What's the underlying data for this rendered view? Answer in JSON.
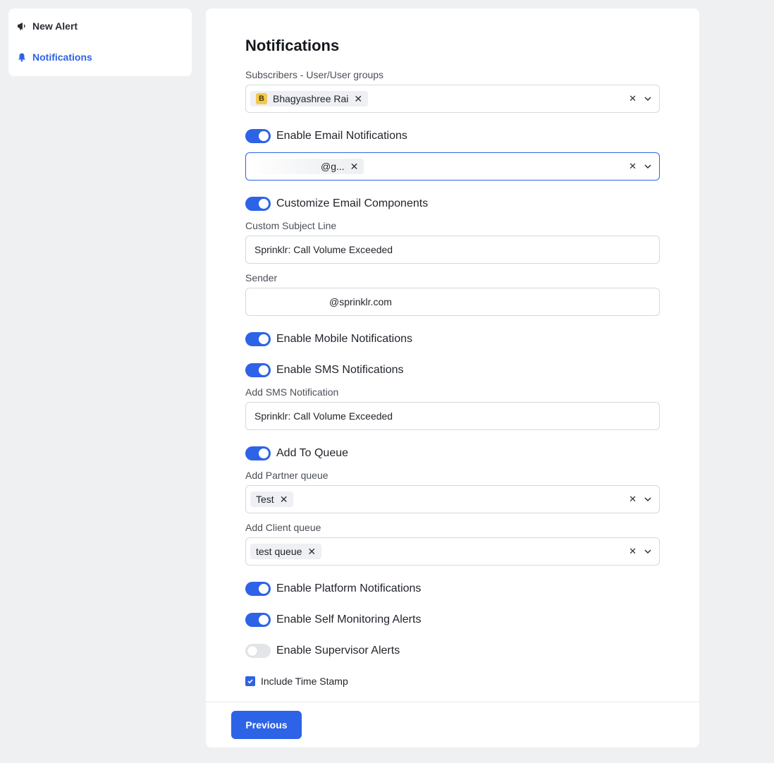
{
  "sidebar": {
    "items": [
      {
        "label": "New Alert",
        "icon": "megaphone-icon",
        "active": false
      },
      {
        "label": "Notifications",
        "icon": "bell-icon",
        "active": true
      }
    ]
  },
  "main": {
    "title": "Notifications",
    "subscribers": {
      "label": "Subscribers - User/User groups",
      "chips": [
        {
          "avatar": "B",
          "text": "Bhagyashree Rai"
        }
      ]
    },
    "email_toggle": {
      "label": "Enable Email Notifications",
      "on": true
    },
    "email_field": {
      "chip_text": "@g..."
    },
    "customize_toggle": {
      "label": "Customize Email Components",
      "on": true
    },
    "subject": {
      "label": "Custom Subject Line",
      "value": "Sprinklr: Call Volume Exceeded"
    },
    "sender": {
      "label": "Sender",
      "value": "@sprinklr.com"
    },
    "mobile_toggle": {
      "label": "Enable Mobile Notifications",
      "on": true
    },
    "sms_toggle": {
      "label": "Enable SMS Notifications",
      "on": true
    },
    "sms": {
      "label": "Add SMS Notification",
      "value": "Sprinklr: Call Volume Exceeded"
    },
    "queue_toggle": {
      "label": "Add To Queue",
      "on": true
    },
    "partner_queue": {
      "label": "Add Partner queue",
      "chips": [
        "Test"
      ]
    },
    "client_queue": {
      "label": "Add Client queue",
      "chips": [
        "test queue"
      ]
    },
    "platform_toggle": {
      "label": "Enable Platform Notifications",
      "on": true
    },
    "self_monitor_toggle": {
      "label": "Enable Self Monitoring Alerts",
      "on": true
    },
    "supervisor_toggle": {
      "label": "Enable Supervisor Alerts",
      "on": false
    },
    "timestamp_checkbox": {
      "label": "Include Time Stamp",
      "checked": true
    }
  },
  "footer": {
    "previous_label": "Previous"
  },
  "colors": {
    "accent": "#2d63e6",
    "background": "#eff0f2",
    "avatar": "#f2c94c"
  }
}
